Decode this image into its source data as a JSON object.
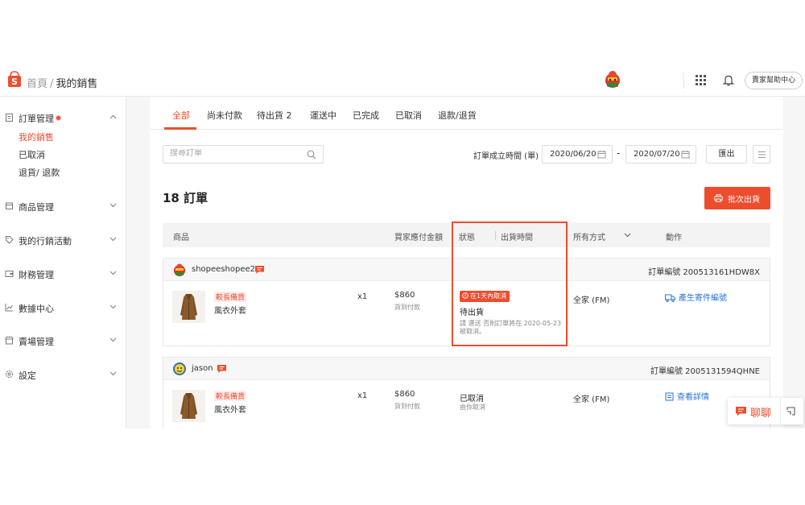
{
  "header": {
    "logo_letter": "S",
    "breadcrumb_home": "首頁",
    "breadcrumb_sep": "/",
    "breadcrumb_current": "我的銷售",
    "help_label": "賣家幫助中心"
  },
  "sidebar": {
    "groups": [
      {
        "label": "訂單管理",
        "icon": "clipboard-icon",
        "expanded": true,
        "sub": [
          "我的銷售",
          "已取消",
          "退貨/ 退款"
        ]
      },
      {
        "label": "商品管理",
        "icon": "box-icon"
      },
      {
        "label": "我的行銷活動",
        "icon": "tag-icon"
      },
      {
        "label": "財務管理",
        "icon": "wallet-icon"
      },
      {
        "label": "數據中心",
        "icon": "chart-icon"
      },
      {
        "label": "賣場管理",
        "icon": "shop-icon"
      },
      {
        "label": "設定",
        "icon": "gear-icon"
      }
    ]
  },
  "tabs": [
    {
      "label": "全部",
      "active": true
    },
    {
      "label": "尚未付款"
    },
    {
      "label": "待出貨 2"
    },
    {
      "label": "運送中"
    },
    {
      "label": "已完成"
    },
    {
      "label": "已取消"
    },
    {
      "label": "退款/退貨"
    }
  ],
  "toolbar": {
    "search_placeholder": "搜尋訂單",
    "date_label": "訂單成立時間 (單)",
    "date_from": "2020/06/20",
    "date_sep": "-",
    "date_to": "2020/07/20",
    "export_label": "匯出"
  },
  "orders_title": "18 訂單",
  "batch_ship_label": "批次出貨",
  "table_headers": {
    "product": "商品",
    "amount": "買家應付金額",
    "status": "狀態",
    "ship_time": "出貨時間",
    "ship_method": "所有方式",
    "action": "動作"
  },
  "orders": [
    {
      "buyer": "shopeeshopee2",
      "order_id": "訂單編號 200513161HDW8X",
      "tag": "較長備貨",
      "product": "風衣外套",
      "qty": "x1",
      "price": "$860",
      "price_sub": "貨到付款",
      "badge": "在1天內取消",
      "status": "待出貨",
      "note_line1": "請 運送 否則訂單將在 2020-05-23",
      "note_line2": "被取消。",
      "ship_method": "全家 (FM)",
      "action": "產生寄件編號"
    },
    {
      "buyer": "jason",
      "order_id": "訂單編號 2005131594QHNE",
      "tag": "較長備貨",
      "product": "風衣外套",
      "qty": "x1",
      "price": "$860",
      "price_sub": "貨到付款",
      "status": "已取消",
      "note_line1": "由你取消",
      "ship_method": "全家 (FM)",
      "action": "查看詳情"
    }
  ],
  "chat_float": {
    "label": "聊聊"
  },
  "colors": {
    "brand": "#ee4d2d",
    "link": "#2673dd"
  }
}
